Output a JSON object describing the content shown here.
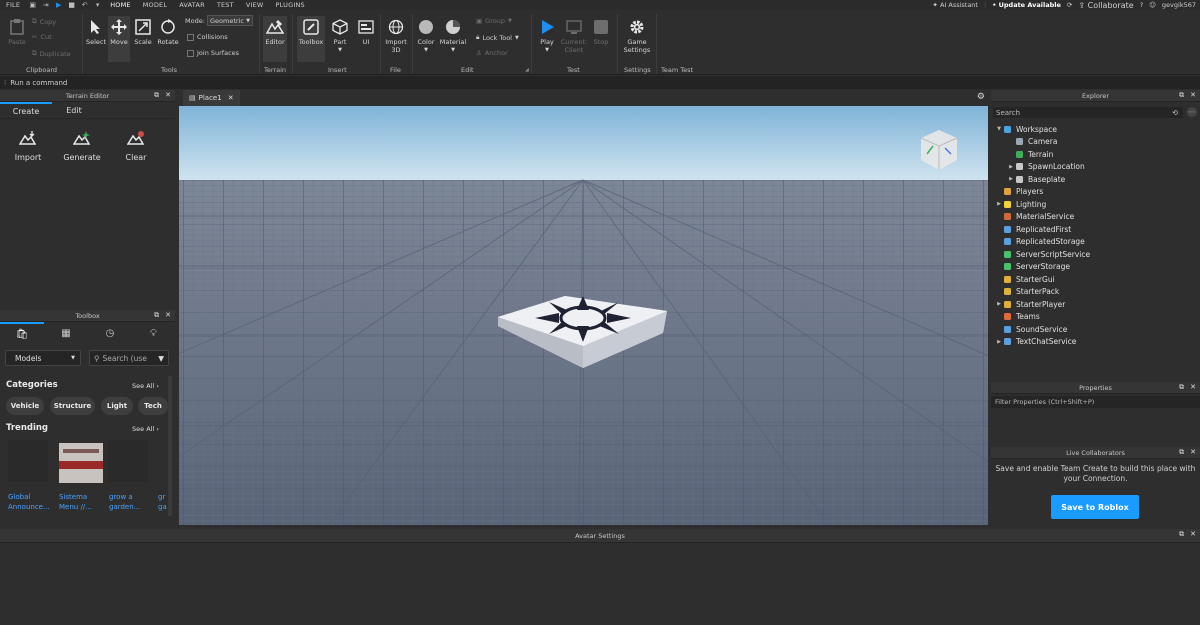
{
  "menu": {
    "file": "FILE",
    "tabs": [
      "HOME",
      "MODEL",
      "AVATAR",
      "TEST",
      "VIEW",
      "PLUGINS"
    ],
    "active_tab": "HOME",
    "ai_assistant": "AI Assistant",
    "update": "Update Available",
    "collaborate": "Collaborate",
    "username": "gevgik567"
  },
  "ribbon": {
    "clipboard": {
      "paste": "Paste",
      "copy": "Copy",
      "cut": "Cut",
      "duplicate": "Duplicate",
      "label": "Clipboard"
    },
    "tools": {
      "select": "Select",
      "move": "Move",
      "scale": "Scale",
      "rotate": "Rotate",
      "mode_label": "Mode:",
      "mode_value": "Geometric",
      "collisions": "Collisions",
      "join_surfaces": "Join Surfaces",
      "label": "Tools"
    },
    "terrain": {
      "editor": "Editor",
      "label": "Terrain"
    },
    "insert": {
      "toolbox": "Toolbox",
      "part": "Part",
      "ui": "UI",
      "label": "Insert"
    },
    "file": {
      "import3d_line1": "Import",
      "import3d_line2": "3D",
      "label": "File"
    },
    "edit": {
      "color": "Color",
      "material": "Material",
      "group": "Group",
      "lock_tool": "Lock Tool",
      "anchor": "Anchor",
      "label": "Edit"
    },
    "test": {
      "play": "Play",
      "current_line1": "Current:",
      "current_line2": "Client",
      "stop": "Stop",
      "label": "Test"
    },
    "settings": {
      "game_line1": "Game",
      "game_line2": "Settings",
      "label": "Settings"
    },
    "team_test": {
      "label": "Team Test"
    }
  },
  "command_bar": {
    "placeholder": "Run a command"
  },
  "terrain_editor": {
    "title": "Terrain Editor",
    "tabs": [
      "Create",
      "Edit"
    ],
    "tools": [
      "Import",
      "Generate",
      "Clear"
    ]
  },
  "toolbox": {
    "title": "Toolbox",
    "category_select": "Models",
    "search_placeholder": "Search (use",
    "categories_label": "Categories",
    "see_all": "See All",
    "category_pills": [
      "Vehicle",
      "Structure",
      "Light",
      "Tech"
    ],
    "trending_label": "Trending",
    "trending": [
      {
        "line1": "Global",
        "line2": "Announce..."
      },
      {
        "line1": "Sistema",
        "line2": "Menu //..."
      },
      {
        "line1": "grow a",
        "line2": "garden..."
      },
      {
        "line1": "gr",
        "line2": "ga"
      }
    ]
  },
  "viewport": {
    "tab": "Place1"
  },
  "explorer": {
    "title": "Explorer",
    "search_placeholder": "Search",
    "items": [
      {
        "label": "Workspace",
        "depth": 0,
        "arrow": "▼",
        "icon": "workspace-icon",
        "color": "#4aa3df"
      },
      {
        "label": "Camera",
        "depth": 1,
        "arrow": "",
        "icon": "camera-icon",
        "color": "#9aa7b5"
      },
      {
        "label": "Terrain",
        "depth": 1,
        "arrow": "",
        "icon": "terrain-icon",
        "color": "#3fae5a"
      },
      {
        "label": "SpawnLocation",
        "depth": 1,
        "arrow": "▶",
        "icon": "spawn-icon",
        "color": "#c8c8c8"
      },
      {
        "label": "Baseplate",
        "depth": 1,
        "arrow": "▶",
        "icon": "part-icon",
        "color": "#c8c8c8"
      },
      {
        "label": "Players",
        "depth": 0,
        "arrow": "",
        "icon": "players-icon",
        "color": "#e0a23b"
      },
      {
        "label": "Lighting",
        "depth": 0,
        "arrow": "▶",
        "icon": "lighting-icon",
        "color": "#f2d13a"
      },
      {
        "label": "MaterialService",
        "depth": 0,
        "arrow": "",
        "icon": "material-service-icon",
        "color": "#d06a3a"
      },
      {
        "label": "ReplicatedFirst",
        "depth": 0,
        "arrow": "",
        "icon": "replicated-first-icon",
        "color": "#5aa0e0"
      },
      {
        "label": "ReplicatedStorage",
        "depth": 0,
        "arrow": "",
        "icon": "replicated-storage-icon",
        "color": "#5aa0e0"
      },
      {
        "label": "ServerScriptService",
        "depth": 0,
        "arrow": "",
        "icon": "server-script-icon",
        "color": "#4cc06a"
      },
      {
        "label": "ServerStorage",
        "depth": 0,
        "arrow": "",
        "icon": "server-storage-icon",
        "color": "#4cc06a"
      },
      {
        "label": "StarterGui",
        "depth": 0,
        "arrow": "",
        "icon": "starter-gui-icon",
        "color": "#e0b03b"
      },
      {
        "label": "StarterPack",
        "depth": 0,
        "arrow": "",
        "icon": "starter-pack-icon",
        "color": "#e0b03b"
      },
      {
        "label": "StarterPlayer",
        "depth": 0,
        "arrow": "▶",
        "icon": "starter-player-icon",
        "color": "#e0b03b"
      },
      {
        "label": "Teams",
        "depth": 0,
        "arrow": "",
        "icon": "teams-icon",
        "color": "#e06a3b"
      },
      {
        "label": "SoundService",
        "depth": 0,
        "arrow": "",
        "icon": "sound-icon",
        "color": "#5aa0e0"
      },
      {
        "label": "TextChatService",
        "depth": 0,
        "arrow": "▶",
        "icon": "text-chat-icon",
        "color": "#5aa0e0"
      }
    ]
  },
  "properties": {
    "title": "Properties",
    "filter_placeholder": "Filter Properties (Ctrl+Shift+P)"
  },
  "live_collaborators": {
    "title": "Live Collaborators",
    "message": "Save and enable Team Create to build this place with your Connection.",
    "button": "Save to Roblox"
  },
  "avatar_settings": {
    "title": "Avatar Settings"
  },
  "colors": {
    "accent": "#1a9bff",
    "panel": "#2e2e2e",
    "header": "#353535",
    "play": "#1e8ef0"
  }
}
